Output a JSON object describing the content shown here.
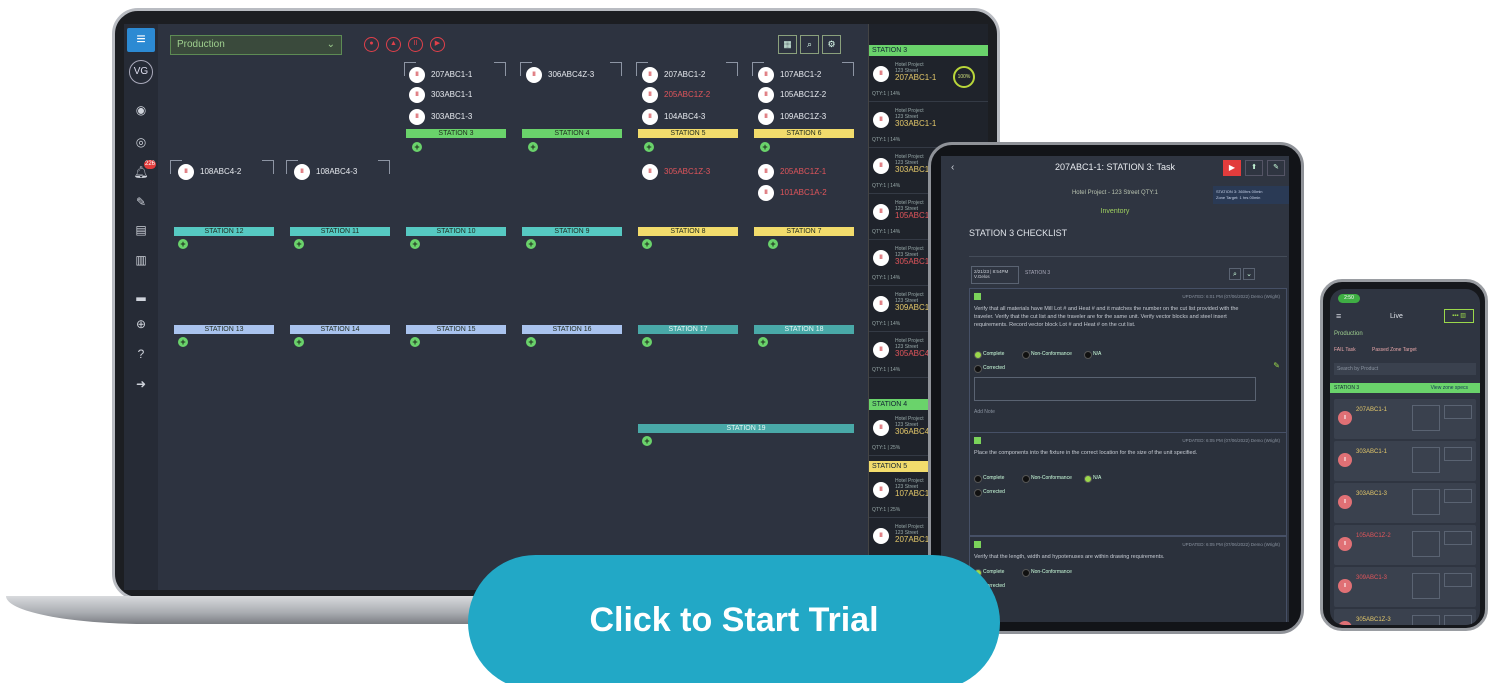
{
  "desktop": {
    "production_select": "Production",
    "avatar_initials": "VG",
    "alert_count": "226",
    "jobs_row1": [
      {
        "id": "207ABC1-1",
        "red": false
      },
      {
        "id": "303ABC1-1",
        "red": false
      },
      {
        "id": "303ABC1-3",
        "red": false
      },
      {
        "id": "306ABC4Z-3",
        "red": false
      },
      {
        "id": "207ABC1-2",
        "red": false
      },
      {
        "id": "205ABC1Z-2",
        "red": true
      },
      {
        "id": "104ABC4-3",
        "red": false
      },
      {
        "id": "107ABC1-2",
        "red": false
      },
      {
        "id": "105ABC1Z-2",
        "red": false
      },
      {
        "id": "109ABC1Z-3",
        "red": false
      }
    ],
    "jobs_row2": [
      {
        "id": "108ABC4-2",
        "red": false
      },
      {
        "id": "108ABC4-3",
        "red": false
      },
      {
        "id": "305ABC1Z-3",
        "red": true
      },
      {
        "id": "205ABC1Z-1",
        "red": true
      },
      {
        "id": "101ABC1A-2",
        "red": true
      }
    ],
    "stations_top": [
      {
        "label": "STATION 3",
        "color": "green"
      },
      {
        "label": "STATION 4",
        "color": "green"
      },
      {
        "label": "STATION 5",
        "color": "yellow"
      },
      {
        "label": "STATION 6",
        "color": "yellow"
      }
    ],
    "stations_mid": [
      {
        "label": "STATION 12",
        "color": "teal"
      },
      {
        "label": "STATION 11",
        "color": "teal"
      },
      {
        "label": "STATION 10",
        "color": "teal"
      },
      {
        "label": "STATION 9",
        "color": "teal"
      },
      {
        "label": "STATION 8",
        "color": "yellow"
      },
      {
        "label": "STATION 7",
        "color": "yellow"
      }
    ],
    "stations_low": [
      {
        "label": "STATION 13",
        "color": "blue"
      },
      {
        "label": "STATION 14",
        "color": "blue"
      },
      {
        "label": "STATION 15",
        "color": "blue"
      },
      {
        "label": "STATION 16",
        "color": "blue"
      },
      {
        "label": "STATION 17",
        "color": "dteal"
      },
      {
        "label": "STATION 18",
        "color": "dteal"
      }
    ],
    "station_19": "STATION 19",
    "right_panel": {
      "groups": [
        {
          "header": "STATION 3",
          "cards": [
            {
              "project": "Hotel Project",
              "street": "123 Street",
              "id": "207ABC1-1",
              "qty": "QTY:1 | 14%"
            },
            {
              "project": "Hotel Project",
              "street": "123 Street",
              "id": "303ABC1-1",
              "qty": "QTY:1 | 14%"
            },
            {
              "project": "Hotel Project",
              "street": "123 Street",
              "id": "303ABC1",
              "qty": "QTY:1 | 14%"
            },
            {
              "project": "Hotel Project",
              "street": "123 Street",
              "id": "105ABC1",
              "qty": "QTY:1 | 14%"
            },
            {
              "project": "Hotel Project",
              "street": "123 Street",
              "id": "305ABC1",
              "qty": "QTY:1 | 14%"
            },
            {
              "project": "Hotel Project",
              "street": "123 Street",
              "id": "309ABC1",
              "qty": "QTY:1 | 14%"
            },
            {
              "project": "Hotel Project",
              "street": "123 Street",
              "id": "305ABC4",
              "qty": "QTY:1 | 14%"
            }
          ]
        },
        {
          "header": "STATION 4",
          "cards": [
            {
              "project": "Hotel Project",
              "street": "123 Street",
              "id": "306ABC4",
              "qty": "QTY:1 | 25%"
            }
          ]
        },
        {
          "header": "STATION 5",
          "cards": [
            {
              "project": "Hotel Project",
              "street": "123 Street",
              "id": "107ABC1",
              "qty": "QTY:1 | 25%"
            },
            {
              "project": "Hotel Project",
              "street": "123 Street",
              "id": "207ABC1",
              "qty": ""
            }
          ]
        }
      ],
      "progress_label": "100%"
    }
  },
  "tablet": {
    "title": "207ABC1-1: STATION 3: Task",
    "subtitle": "Hotel Project - 123 Street QTY:1",
    "inventory": "Inventory",
    "checklist_heading": "STATION 3 CHECKLIST",
    "entry_date": "2/21/23 | 8:54PM",
    "entry_user": "V.Gelos",
    "entry_station": "STATION 3",
    "side_note": "STATION 3: 360hrs 00min\nZone Target: 1 hrs 00min",
    "items": [
      {
        "updated": "UPDATED: 6:01 PM (07/06/2022) Demo (Wright)",
        "text": "Verify that all materials have Mill Lot # and Heat # and it matches the number on the cut list provided with the traveler. Verify that the cut list and the traveler are for the same unit. Verify vector blocks and steel insert requirements. Record vector block Lot # and Heat # on the cut list.",
        "selected": "Complete"
      },
      {
        "updated": "UPDATED: 6:05 PM (07/06/2022) Demo (Wright)",
        "text": "Place the components into the fixture in the correct location for the size of the unit specified.",
        "selected": "N/A"
      },
      {
        "updated": "UPDATED: 6:05 PM (07/06/2022) Demo (Wright)",
        "text": "Verify that the length, width and hypotenuses are within drawing requirements.",
        "selected": "Complete"
      }
    ],
    "options": [
      "Complete",
      "Non-Conformance",
      "N/A"
    ],
    "corrected": "Corrected",
    "add_note": "Add Note"
  },
  "phone": {
    "time": "2:50",
    "screen_title": "Live",
    "production": "Production",
    "filter_1": "FAIL Task",
    "filter_2": "Passed Zone Target",
    "search_placeholder": "Search by Product",
    "station_header": "STATION 3",
    "view_link": "View zone specs",
    "cards": [
      {
        "id": "207ABC1-1",
        "red": false
      },
      {
        "id": "303ABC1-1",
        "red": false
      },
      {
        "id": "303ABC1-3",
        "red": false
      },
      {
        "id": "105ABC1Z-2",
        "red": true
      },
      {
        "id": "309ABC1-3",
        "red": true
      },
      {
        "id": "305ABC1Z-3",
        "red": false
      }
    ]
  },
  "cta": {
    "label": "Click to Start Trial"
  }
}
